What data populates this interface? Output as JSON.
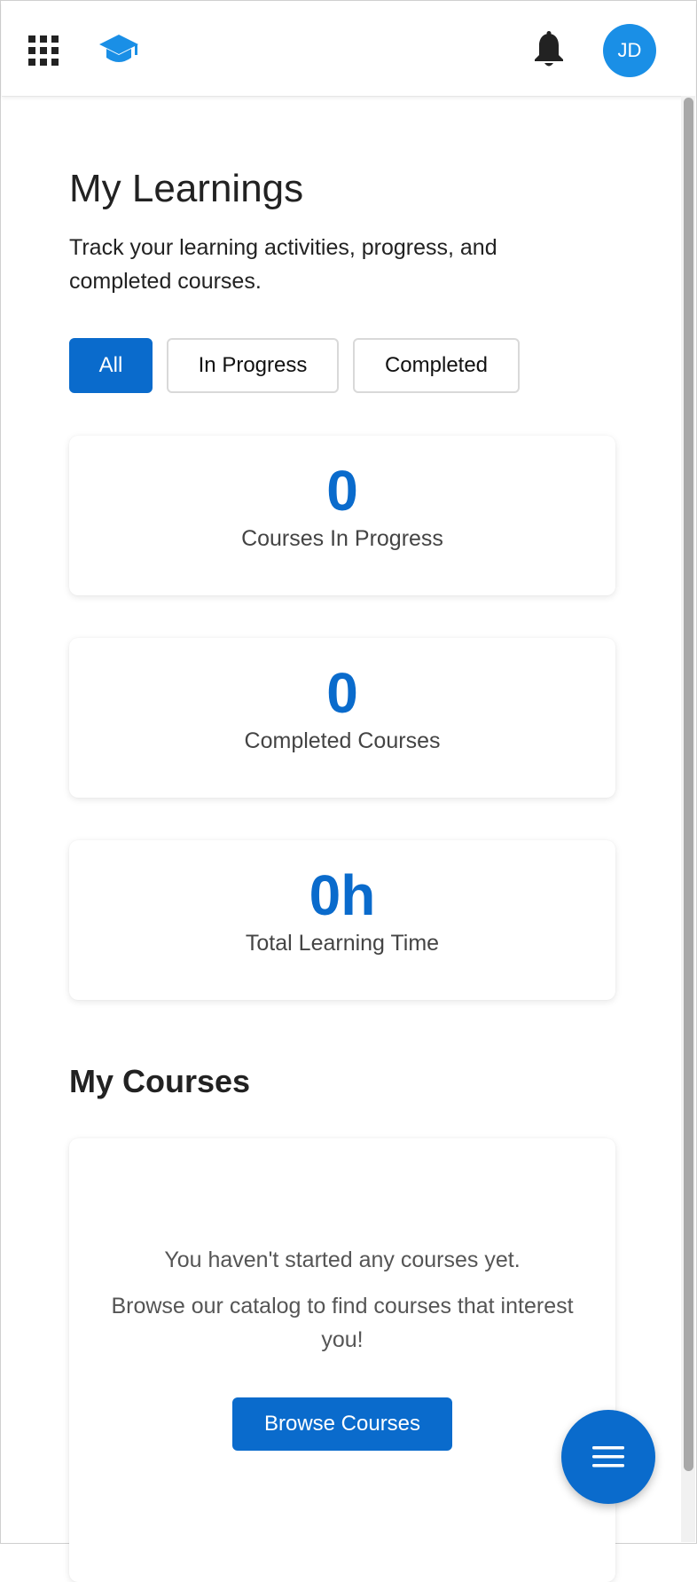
{
  "header": {
    "avatar_initials": "JD",
    "icons": {
      "apps": "apps-grid-icon",
      "logo": "graduation-cap-icon",
      "notifications": "bell-icon"
    }
  },
  "page": {
    "title": "My Learnings",
    "subtitle": "Track your learning activities, progress, and completed courses."
  },
  "filters": [
    {
      "label": "All",
      "active": true
    },
    {
      "label": "In Progress",
      "active": false
    },
    {
      "label": "Completed",
      "active": false
    }
  ],
  "stats": [
    {
      "value": "0",
      "label": "Courses In Progress"
    },
    {
      "value": "0",
      "label": "Completed Courses"
    },
    {
      "value": "0h",
      "label": "Total Learning Time"
    }
  ],
  "courses": {
    "heading": "My Courses",
    "empty_title": "You haven't started any courses yet.",
    "empty_message": "Browse our catalog to find courses that interest you!",
    "browse_label": "Browse Courses"
  },
  "fab": {
    "icon": "menu-icon"
  },
  "colors": {
    "primary": "#0a6bcc",
    "avatar": "#1a8fe6",
    "text": "#222222",
    "muted": "#555555"
  }
}
